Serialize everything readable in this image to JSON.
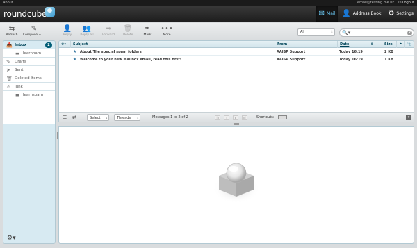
{
  "topbar": {
    "about": "About",
    "email": "email@testing.me.uk",
    "logout": "Logout"
  },
  "brand": {
    "name": "roundcube"
  },
  "taskbar": [
    {
      "label": "Mail",
      "icon": "envelope-icon",
      "active": true
    },
    {
      "label": "Address Book",
      "icon": "person-icon",
      "active": false
    },
    {
      "label": "Settings",
      "icon": "gear-icon",
      "active": false
    }
  ],
  "toolbar": {
    "refresh": "Refresh",
    "compose": "Compose + ...",
    "reply": "Reply",
    "reply_all": "Reply all",
    "forward": "Forward",
    "delete": "Delete",
    "mark": "Mark",
    "more": "More"
  },
  "filter": {
    "selected": "All"
  },
  "search": {
    "placeholder": "",
    "value": ""
  },
  "folders": [
    {
      "label": "Inbox",
      "unread": "2",
      "selected": true,
      "sub": false,
      "icon": "inbox-icon"
    },
    {
      "label": "learnham",
      "sub": true,
      "icon": "folder-icon"
    },
    {
      "label": "Drafts",
      "sub": false,
      "icon": "pencil-icon"
    },
    {
      "label": "Sent",
      "sub": false,
      "icon": "sent-icon"
    },
    {
      "label": "Deleted Items",
      "sub": false,
      "icon": "trash-icon"
    },
    {
      "label": "Junk",
      "sub": false,
      "icon": "junk-icon"
    },
    {
      "label": "learnspam",
      "sub": true,
      "icon": "folder-icon"
    }
  ],
  "list": {
    "columns": {
      "subject": "Subject",
      "from": "From",
      "date": "Date",
      "size": "Size"
    },
    "rows": [
      {
        "subject": "About The special spam folders",
        "from": "AAISP Support",
        "date": "Today 16:19",
        "size": "2 KB"
      },
      {
        "subject": "Welcome to your new Mailbox email, read this first!",
        "from": "AAISP Support",
        "date": "Today 16:19",
        "size": "1 KB"
      }
    ]
  },
  "listfooter": {
    "select": "Select",
    "threads": "Threads",
    "count": "Messages 1 to 2 of 2",
    "shortcuts": "Shortcuts:"
  },
  "colors": {
    "accent": "#6cc9f4",
    "header": "#2a2a2a",
    "selected_folder": "#d7eaf2",
    "badge": "#005d76"
  }
}
